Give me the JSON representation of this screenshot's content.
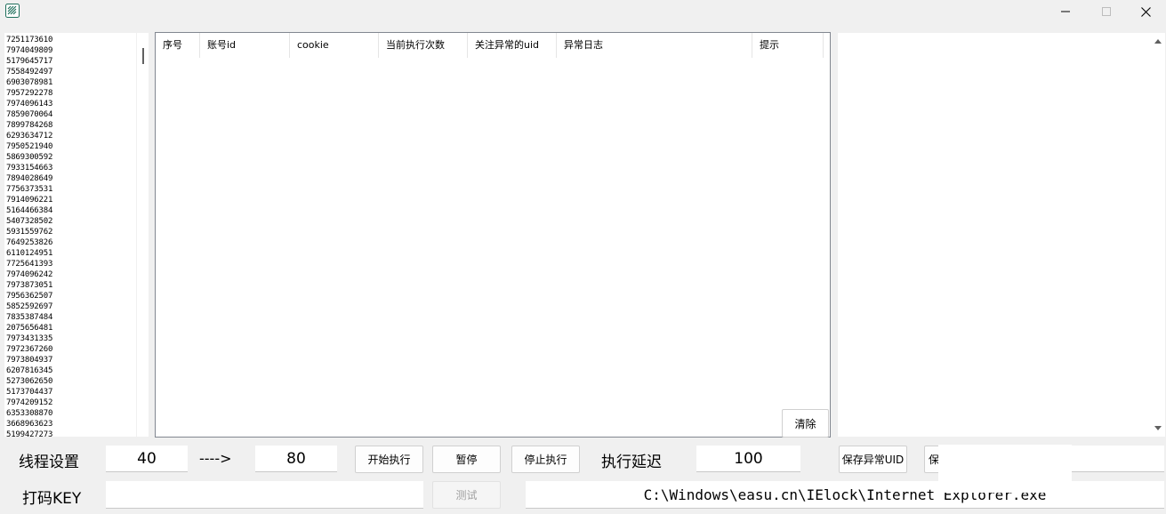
{
  "window": {
    "icon": "app-logo-icon",
    "controls": [
      "minimize-icon",
      "maximize-icon",
      "close-icon"
    ]
  },
  "uid_list": [
    "7251173610",
    "7974049809",
    "5179645717",
    "7558492497",
    "6903078981",
    "7957292278",
    "7974096143",
    "7859070064",
    "7899784268",
    "6293634712",
    "7950521940",
    "5869300592",
    "7933154663",
    "7894028649",
    "7756373531",
    "7914096221",
    "5164466384",
    "5407328502",
    "5931559762",
    "7649253826",
    "6110124951",
    "7725641393",
    "7974096242",
    "7973873051",
    "7956362507",
    "5852592697",
    "7835387484",
    "2075656481",
    "7973431335",
    "7972367260",
    "7973804937",
    "6207816345",
    "5273062650",
    "5173704437",
    "7974209152",
    "6353308870",
    "3668963623",
    "5199427273"
  ],
  "table": {
    "columns": [
      "序号",
      "账号id",
      "cookie",
      "当前执行次数",
      "关注异常的uid",
      "异常日志",
      "提示"
    ]
  },
  "buttons": {
    "clear": "清除",
    "start": "开始执行",
    "pause": "暂停",
    "stop": "停止执行",
    "save_abnormal": "保存异常UID",
    "save_partial": "保",
    "test": "测试"
  },
  "controls": {
    "thread_label": "线程设置",
    "thread_min": "40",
    "arrow": "---->",
    "thread_max": "80",
    "delay_label": "执行延迟",
    "delay_value": "100",
    "key_label": "打码KEY",
    "key_value": "",
    "path_value": "C:\\Windows\\easu.cn\\IElock\\Internet Explorer.exe"
  }
}
